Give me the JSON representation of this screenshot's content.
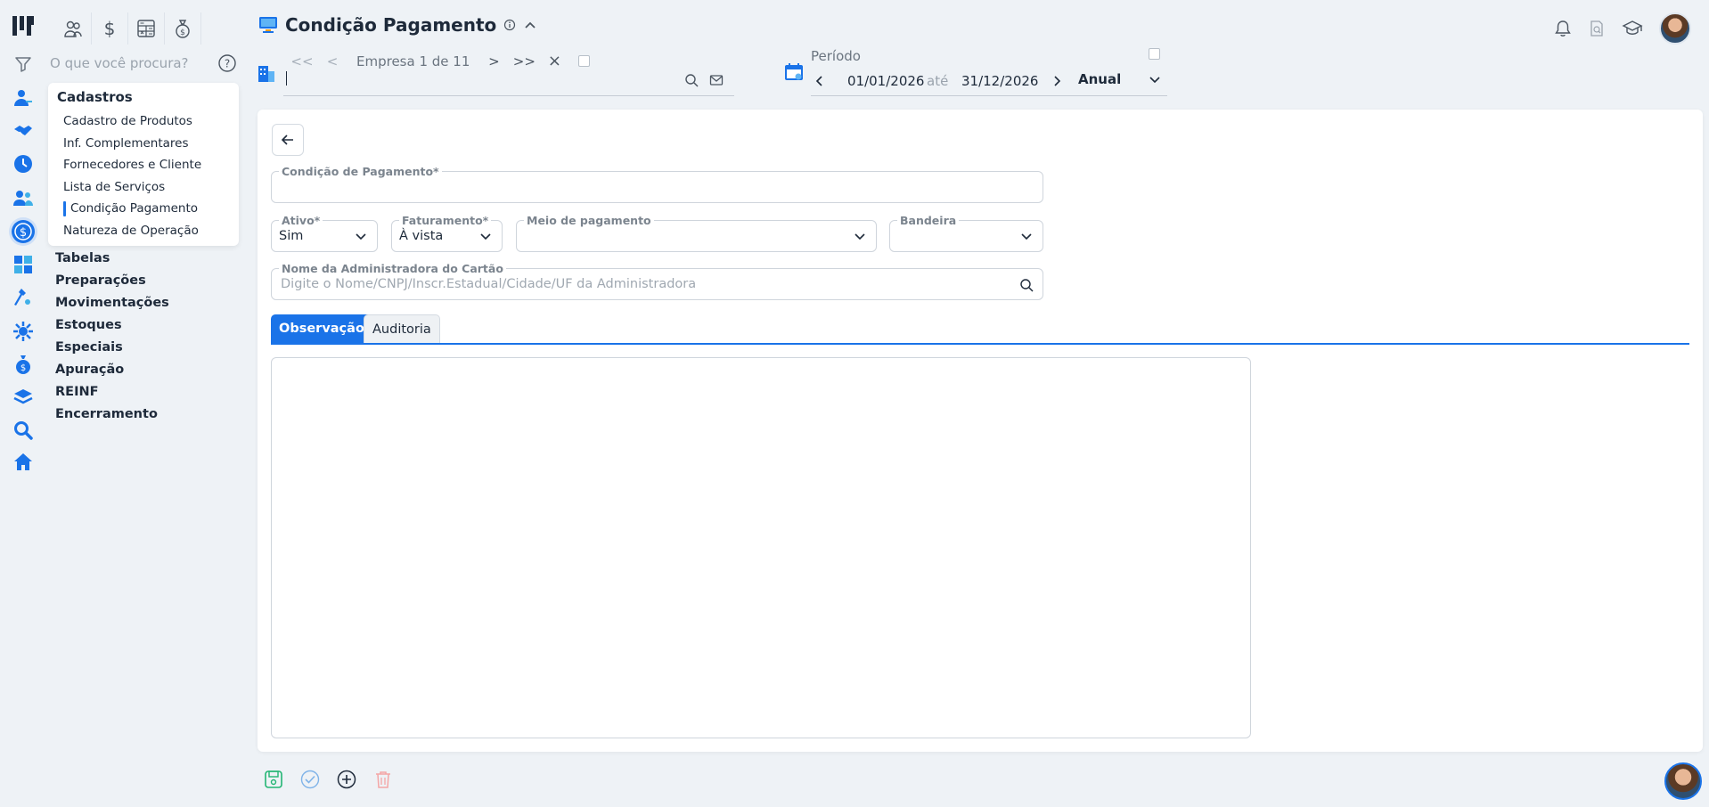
{
  "app": {
    "title": "Condição Pagamento"
  },
  "colors": {
    "accent": "#1a73e8",
    "background": "#eef2f6"
  },
  "search": {
    "placeholder": "O que você procura?"
  },
  "modules": [
    {
      "icon": "users-icon"
    },
    {
      "icon": "dollar-icon"
    },
    {
      "icon": "calculator-icon"
    },
    {
      "icon": "money-bag-icon"
    }
  ],
  "sidebar": {
    "rail_icons": [
      "user-register-icon",
      "handshake-icon",
      "clock-icon",
      "people-icon",
      "dollar-circle-icon",
      "table-icon",
      "tool-icon",
      "gear-network-icon",
      "money-bag-icon",
      "layers-icon",
      "magnifier-icon",
      "home-icon"
    ],
    "submenu": {
      "title": "Cadastros",
      "items": [
        {
          "label": "Cadastro de Produtos"
        },
        {
          "label": "Inf. Complementares"
        },
        {
          "label": "Fornecedores e Cliente"
        },
        {
          "label": "Lista de Serviços"
        },
        {
          "label": "Condição Pagamento"
        },
        {
          "label": "Natureza de Operação"
        }
      ]
    },
    "groups": [
      {
        "label": "Tabelas"
      },
      {
        "label": "Preparações"
      },
      {
        "label": "Movimentações"
      },
      {
        "label": "Estoques"
      },
      {
        "label": "Especiais"
      },
      {
        "label": "Apuração"
      },
      {
        "label": "REINF"
      },
      {
        "label": "Encerramento"
      }
    ]
  },
  "company_nav": {
    "first": "<<",
    "prev": "<",
    "label": "Empresa 1 de 11",
    "next": ">",
    "last": ">>",
    "clear": "×",
    "input_value": ""
  },
  "period": {
    "label": "Período",
    "start": "01/01/2026",
    "separator": "até",
    "end": "31/12/2026",
    "mode": "Anual"
  },
  "form": {
    "condicao": {
      "label": "Condição de Pagamento*",
      "value": ""
    },
    "ativo": {
      "label": "Ativo*",
      "value": "Sim"
    },
    "faturamento": {
      "label": "Faturamento*",
      "value": "À vista"
    },
    "meio": {
      "label": "Meio de pagamento",
      "value": ""
    },
    "bandeira": {
      "label": "Bandeira",
      "value": ""
    },
    "administradora": {
      "label": "Nome da Administradora do Cartão",
      "placeholder": "Digite o Nome/CNPJ/Inscr.Estadual/Cidade/UF da Administradora"
    }
  },
  "tabs": [
    {
      "label": "Observação",
      "active": true
    },
    {
      "label": "Auditoria",
      "active": false
    }
  ],
  "observacao": {
    "value": ""
  }
}
